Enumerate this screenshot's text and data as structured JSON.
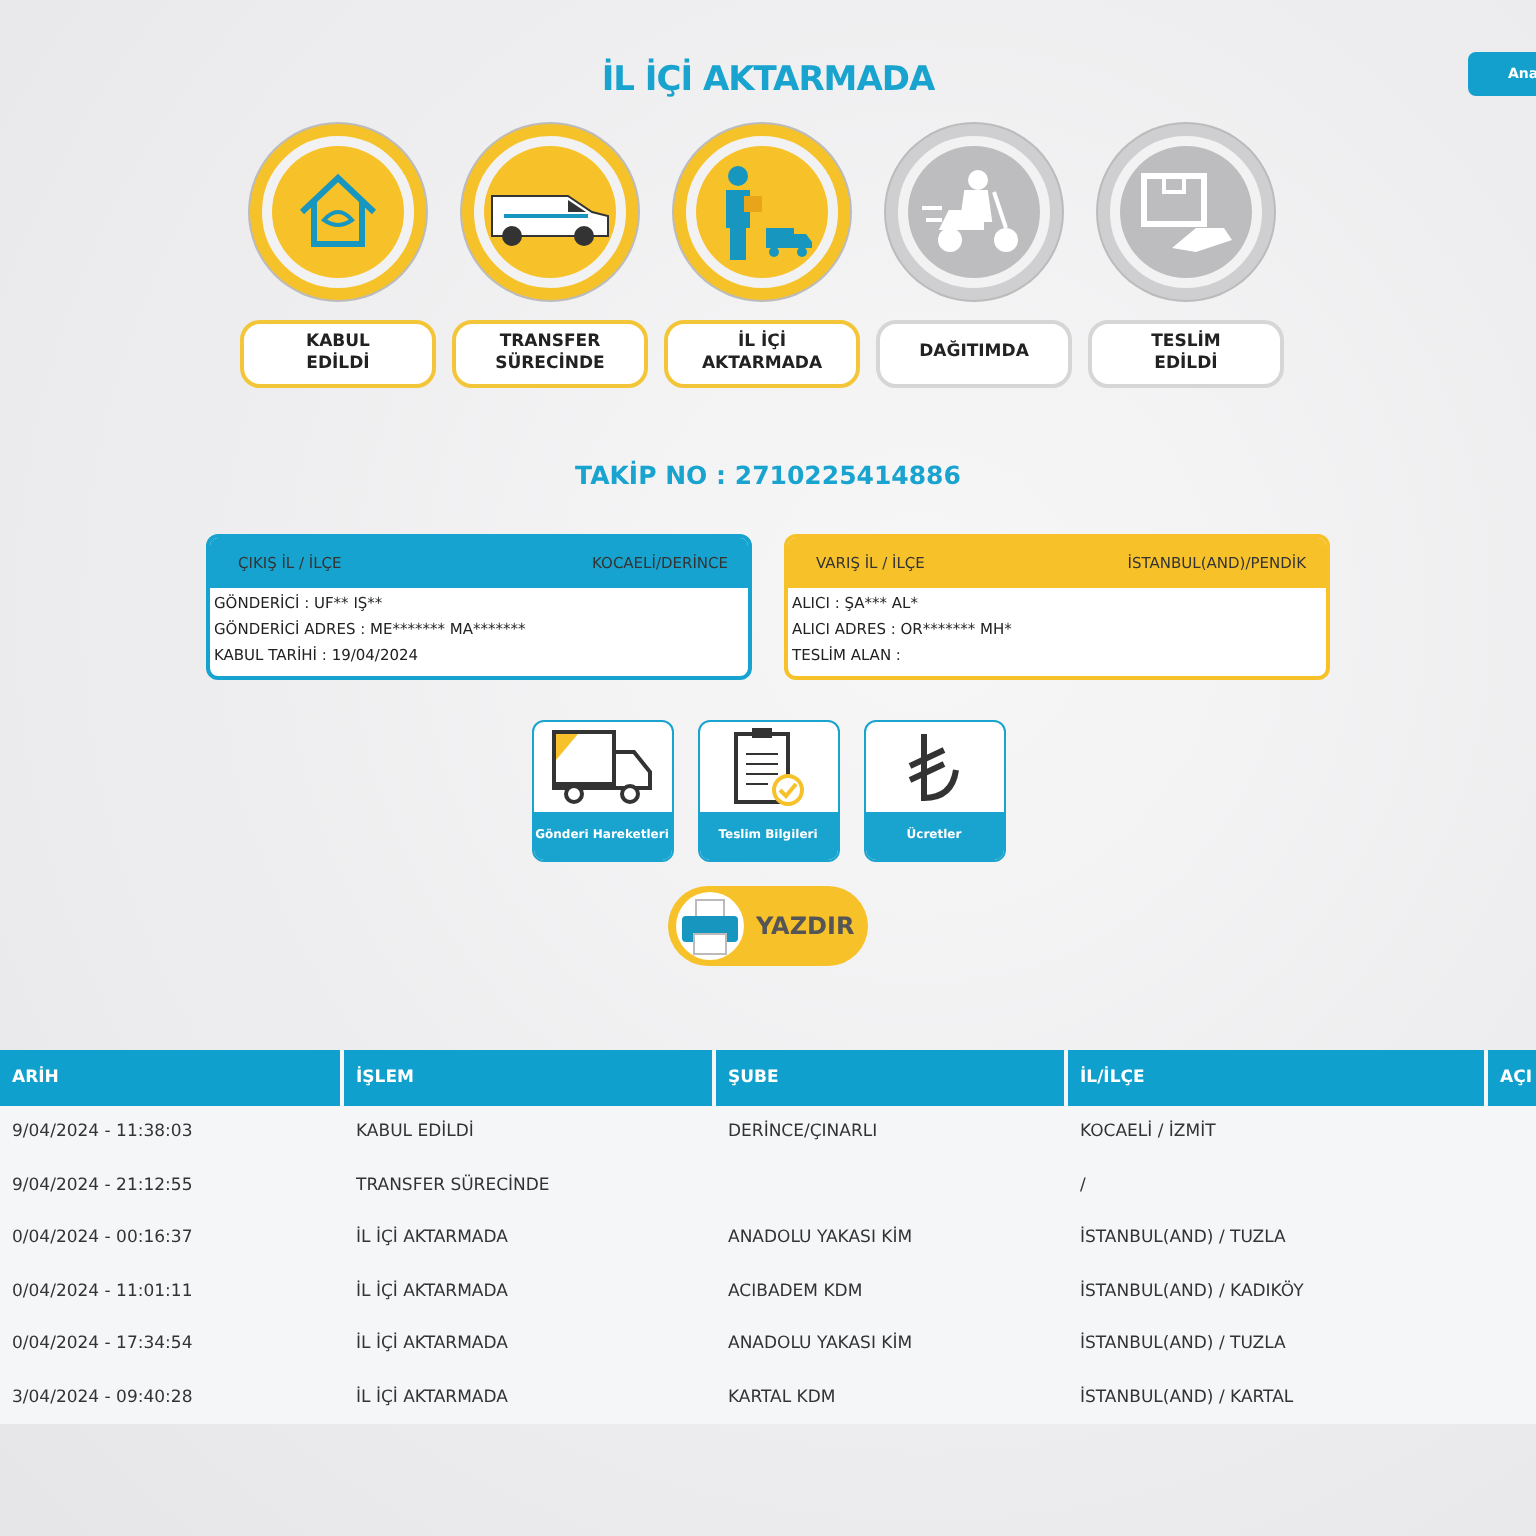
{
  "top_button": "Ana",
  "title": "İL İÇİ AKTARMADA",
  "steps": [
    {
      "label": "KABUL EDİLDİ",
      "done": true
    },
    {
      "label": "TRANSFER SÜRECİNDE",
      "done": true
    },
    {
      "label": "İL İÇİ AKTARMADA",
      "done": true
    },
    {
      "label": "DAĞITIMDA",
      "done": false
    },
    {
      "label": "TESLİM EDİLDİ",
      "done": false
    }
  ],
  "tracking": "TAKİP NO : 2710225414886",
  "cards": [
    {
      "kind": "origin",
      "heading": "ÇIKIŞ İL / İLÇE",
      "place": "KOCAELİ/DERİNCE",
      "lines": [
        "GÖNDERİCİ : UF** IŞ**",
        "GÖNDERİCİ ADRES : ME******* MA*******",
        "KABUL TARİHİ : 19/04/2024"
      ]
    },
    {
      "kind": "destination",
      "heading": "VARIŞ İL / İLÇE",
      "place": "İSTANBUL(AND)/PENDİK",
      "lines": [
        "ALICI : ŞA*** AL*",
        "ALICI ADRES : OR******* MH*",
        "TESLİM ALAN :"
      ]
    }
  ],
  "tiles": [
    {
      "label": "Gönderi Hareketleri"
    },
    {
      "label": "Teslim Bilgileri"
    },
    {
      "label": "Ücretler"
    }
  ],
  "print_button": "YAZDIR",
  "table": {
    "columns": [
      "ARİH",
      "İŞLEM",
      "ŞUBE",
      "İL/İLÇE",
      "AÇI"
    ],
    "rows": [
      [
        "9/04/2024 - 11:38:03",
        "KABUL EDİLDİ",
        "DERİNCE/ÇINARLI",
        "KOCAELİ / İZMİT"
      ],
      [
        "9/04/2024 - 21:12:55",
        "TRANSFER SÜRECİNDE",
        "",
        "/"
      ],
      [
        "0/04/2024 - 00:16:37",
        "İL İÇİ AKTARMADA",
        "ANADOLU YAKASI KİM",
        "İSTANBUL(AND) / TUZLA"
      ],
      [
        "0/04/2024 - 11:01:11",
        "İL İÇİ AKTARMADA",
        "ACIBADEM KDM",
        "İSTANBUL(AND) / KADIKÖY"
      ],
      [
        "0/04/2024 - 17:34:54",
        "İL İÇİ AKTARMADA",
        "ANADOLU YAKASI KİM",
        "İSTANBUL(AND) / TUZLA"
      ],
      [
        "3/04/2024 - 09:40:28",
        "İL İÇİ AKTARMADA",
        "KARTAL KDM",
        "İSTANBUL(AND) / KARTAL"
      ]
    ]
  }
}
